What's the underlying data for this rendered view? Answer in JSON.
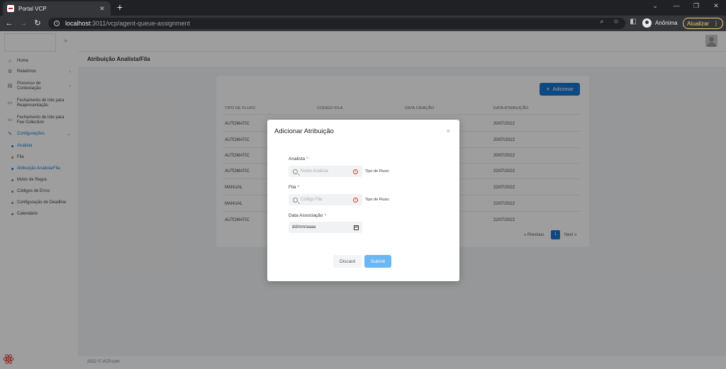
{
  "browser": {
    "tab_title": "Portal VCP",
    "tab_close": "✕",
    "new_tab": "+",
    "url_host": "localhost",
    "url_path": ":3011/vcp/agent-queue-assignment",
    "profile": "Anônima",
    "update_label": "Atualizar",
    "update_dots": "⋮"
  },
  "sidebar": {
    "menu": [
      {
        "label": "Home",
        "icon": "home-icon"
      },
      {
        "label": "Relatórios",
        "icon": "reports-icon"
      },
      {
        "label": "Processo de Contestação",
        "icon": "folder-icon"
      },
      {
        "label": "Fechamento de lote para Reapresentação",
        "icon": "document-icon"
      },
      {
        "label": "Fechamento de lote para Fee Collection",
        "icon": "document-icon"
      },
      {
        "label": "Configurações",
        "icon": "wrench-icon"
      }
    ],
    "submenu": [
      {
        "label": "Analista"
      },
      {
        "label": "Fila"
      },
      {
        "label": "Atribuição Analista/Fila"
      },
      {
        "label": "Motor de Regra"
      },
      {
        "label": "Códigos de Erros"
      },
      {
        "label": "Configuração de Deadline"
      },
      {
        "label": "Calendário"
      }
    ]
  },
  "page": {
    "title": "Atribuição Analista/Fila",
    "add_label": "Adicionar",
    "footer": "2022 © VCP.com"
  },
  "table": {
    "headers": [
      "TIPO DE FLUXO",
      "CODIGO FILA",
      "DATA CRIAÇÃO",
      "DATA ATRIBUIÇÃO"
    ],
    "rows": [
      {
        "tipo": "AUTOMATIC",
        "data": "20/07/2022"
      },
      {
        "tipo": "AUTOMATIC",
        "data": "20/07/2022"
      },
      {
        "tipo": "AUTOMATIC",
        "data": "20/07/2022"
      },
      {
        "tipo": "AUTOMATIC",
        "data": "22/07/2022"
      },
      {
        "tipo": "MANUAL",
        "data": "22/07/2022"
      },
      {
        "tipo": "MANUAL",
        "data": "22/07/2022"
      },
      {
        "tipo": "AUTOMATIC",
        "data": "22/07/2022"
      }
    ],
    "pager": {
      "previous": "« Previous",
      "page": "1",
      "next": "Next »"
    }
  },
  "modal": {
    "title": "Adicionar Atribuição",
    "close": "×",
    "analista_label": "Analista",
    "analista_placeholder": "Nome Analista",
    "fila_label": "Fila",
    "fila_placeholder": "Código Fila",
    "tipo_fluxo": "Tipo de Fluxo:",
    "date_label": "Data Associação",
    "date_value": "dd/mm/aaaa",
    "required": "*",
    "discard": "Discard",
    "submit": "Submit"
  }
}
